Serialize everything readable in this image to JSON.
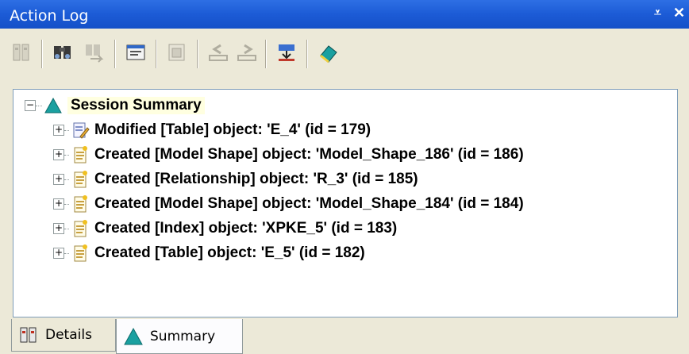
{
  "window": {
    "title": "Action Log",
    "pin_glyph": "⩡",
    "close_glyph": "✕"
  },
  "toolbar": {
    "buttons": [
      {
        "name": "details-icon",
        "enabled": false
      },
      {
        "name": "find-icon",
        "enabled": true
      },
      {
        "name": "find-next-icon",
        "enabled": false
      },
      {
        "name": "properties-icon",
        "enabled": true
      },
      {
        "name": "preview-icon",
        "enabled": false
      },
      {
        "name": "undo-icon",
        "enabled": false
      },
      {
        "name": "redo-icon",
        "enabled": false
      },
      {
        "name": "filter-icon",
        "enabled": true
      },
      {
        "name": "erase-icon",
        "enabled": true
      }
    ]
  },
  "tree": {
    "root": {
      "label": "Session Summary",
      "expander": "−",
      "icon": "summary-triangle-icon"
    },
    "items": [
      {
        "label": "Modified [Table] object: 'E_4' (id = 179)",
        "icon": "modified-doc-icon",
        "expander": "+"
      },
      {
        "label": "Created [Model Shape] object: 'Model_Shape_186' (id = 186)",
        "icon": "created-doc-icon",
        "expander": "+"
      },
      {
        "label": "Created [Relationship] object: 'R_3' (id = 185)",
        "icon": "created-doc-icon",
        "expander": "+"
      },
      {
        "label": "Created [Model Shape] object: 'Model_Shape_184' (id = 184)",
        "icon": "created-doc-icon",
        "expander": "+"
      },
      {
        "label": "Created [Index] object: 'XPKE_5' (id = 183)",
        "icon": "created-doc-icon",
        "expander": "+"
      },
      {
        "label": "Created [Table] object: 'E_5' (id = 182)",
        "icon": "created-doc-icon",
        "expander": "+"
      }
    ]
  },
  "tabs": [
    {
      "label": "Details",
      "icon": "details-tab-icon",
      "active": false
    },
    {
      "label": "Summary",
      "icon": "summary-tab-icon",
      "active": true
    }
  ],
  "colors": {
    "titlebar": "#1c5bd6",
    "teal": "#1aa0a0",
    "selection": "#ffffe0"
  }
}
